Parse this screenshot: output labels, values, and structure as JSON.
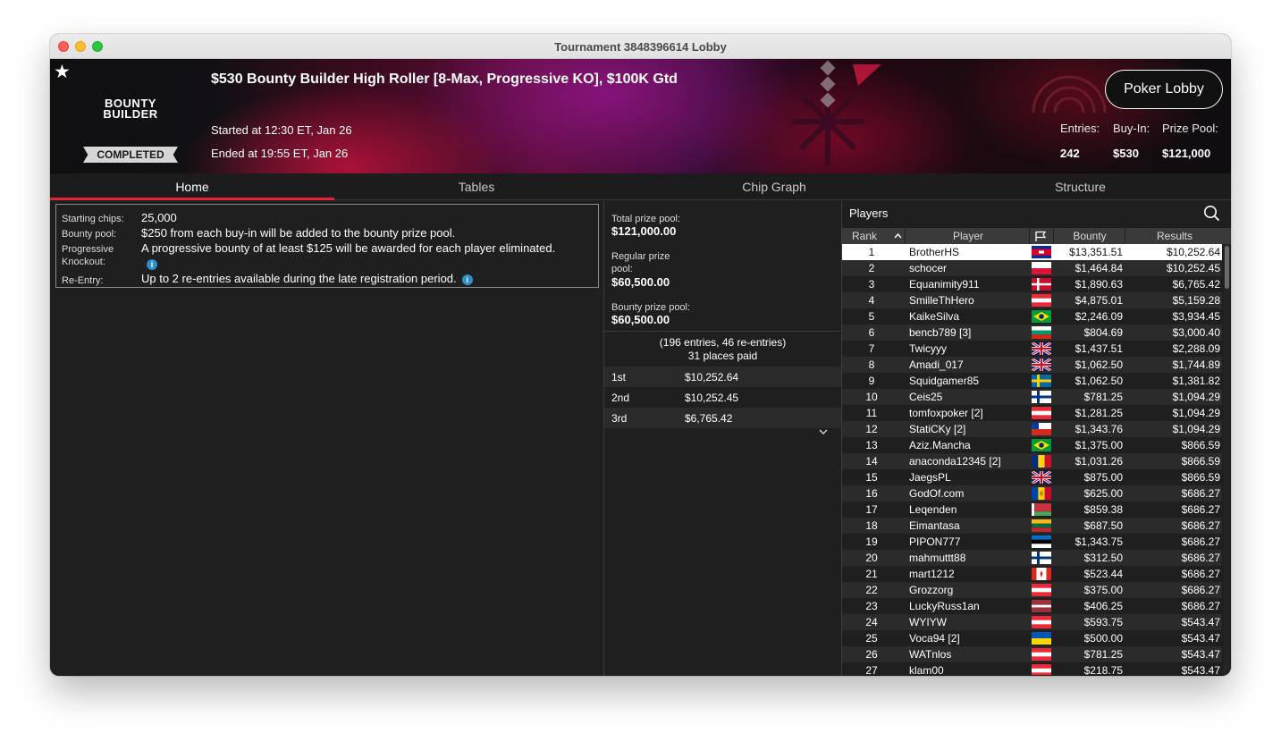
{
  "window": {
    "title": "Tournament 3848396614 Lobby"
  },
  "banner": {
    "logo_line1": "BOUNTY",
    "logo_line2": "BUILDER",
    "status": "COMPLETED",
    "title": "$530 Bounty Builder High Roller [8-Max, Progressive KO], $100K Gtd",
    "started": "Started at 12:30 ET, Jan 26",
    "ended": "Ended at 19:55 ET, Jan 26",
    "lobby_button": "Poker Lobby",
    "stats": [
      {
        "label": "Entries:",
        "value": "242"
      },
      {
        "label": "Buy-In:",
        "value": "$530"
      },
      {
        "label": "Prize Pool:",
        "value": "$121,000"
      }
    ]
  },
  "tabs": [
    "Home",
    "Tables",
    "Chip Graph",
    "Structure"
  ],
  "info": {
    "starting_chips_label": "Starting chips:",
    "starting_chips": "25,000",
    "bounty_pool_label": "Bounty pool:",
    "bounty_pool": "$250 from each buy-in will be added to the bounty prize pool.",
    "pko_label": "Progressive Knockout:",
    "pko": "A progressive bounty of at least $125 will be awarded for each player eliminated.",
    "reentry_label": "Re-Entry:",
    "reentry": "Up to 2 re-entries available during the late registration period."
  },
  "prizes": {
    "total_label": "Total prize pool:",
    "total": "$121,000.00",
    "regular_label": "Regular prize pool:",
    "regular": "$60,500.00",
    "bounty_label": "Bounty prize pool:",
    "bounty": "$60,500.00",
    "entries_line": "(196 entries, 46 re-entries)",
    "places_line": "31 places paid",
    "payouts": [
      {
        "place": "1st",
        "amount": "$10,252.64"
      },
      {
        "place": "2nd",
        "amount": "$10,252.45"
      },
      {
        "place": "3rd",
        "amount": "$6,765.42"
      }
    ]
  },
  "players": {
    "header": "Players",
    "columns": {
      "rank": "Rank",
      "player": "Player",
      "bounty": "Bounty",
      "results": "Results"
    },
    "rows": [
      {
        "rank": "1",
        "name": "BrotherHS",
        "flag": "cambodia",
        "bounty": "$13,351.51",
        "result": "$10,252.64"
      },
      {
        "rank": "2",
        "name": "schocer",
        "flag": "poland",
        "bounty": "$1,464.84",
        "result": "$10,252.45"
      },
      {
        "rank": "3",
        "name": "Equanimity911",
        "flag": "denmark",
        "bounty": "$1,890.63",
        "result": "$6,765.42"
      },
      {
        "rank": "4",
        "name": "SmilleThHero",
        "flag": "austria",
        "bounty": "$4,875.01",
        "result": "$5,159.28"
      },
      {
        "rank": "5",
        "name": "KaikeSilva",
        "flag": "brazil",
        "bounty": "$2,246.09",
        "result": "$3,934.45"
      },
      {
        "rank": "6",
        "name": "bencb789 [3]",
        "flag": "bulgaria",
        "bounty": "$804.69",
        "result": "$3,000.40"
      },
      {
        "rank": "7",
        "name": "Twicyyy",
        "flag": "uk",
        "bounty": "$1,437.51",
        "result": "$2,288.09"
      },
      {
        "rank": "8",
        "name": "Amadi_017",
        "flag": "uk",
        "bounty": "$1,062.50",
        "result": "$1,744.89"
      },
      {
        "rank": "9",
        "name": "Squidgamer85",
        "flag": "sweden",
        "bounty": "$1,062.50",
        "result": "$1,381.82"
      },
      {
        "rank": "10",
        "name": "Ceis25",
        "flag": "finland",
        "bounty": "$781.25",
        "result": "$1,094.29"
      },
      {
        "rank": "11",
        "name": "tomfoxpoker [2]",
        "flag": "austria",
        "bounty": "$1,281.25",
        "result": "$1,094.29"
      },
      {
        "rank": "12",
        "name": "StatiCKy [2]",
        "flag": "chile",
        "bounty": "$1,343.76",
        "result": "$1,094.29"
      },
      {
        "rank": "13",
        "name": "Aziz.Mancha",
        "flag": "brazil",
        "bounty": "$1,375.00",
        "result": "$866.59"
      },
      {
        "rank": "14",
        "name": "anaconda12345 [2]",
        "flag": "romania",
        "bounty": "$1,031.26",
        "result": "$866.59"
      },
      {
        "rank": "15",
        "name": "JaegsPL",
        "flag": "uk",
        "bounty": "$875.00",
        "result": "$866.59"
      },
      {
        "rank": "16",
        "name": "GodOf.com",
        "flag": "moldova",
        "bounty": "$625.00",
        "result": "$686.27"
      },
      {
        "rank": "17",
        "name": "Leqenden",
        "flag": "belarus",
        "bounty": "$859.38",
        "result": "$686.27"
      },
      {
        "rank": "18",
        "name": "Eimantasa",
        "flag": "lithuania",
        "bounty": "$687.50",
        "result": "$686.27"
      },
      {
        "rank": "19",
        "name": "PIPON777",
        "flag": "estonia",
        "bounty": "$1,343.75",
        "result": "$686.27"
      },
      {
        "rank": "20",
        "name": "mahmuttt88",
        "flag": "finland",
        "bounty": "$312.50",
        "result": "$686.27"
      },
      {
        "rank": "21",
        "name": "mart1212",
        "flag": "canada",
        "bounty": "$523.44",
        "result": "$686.27"
      },
      {
        "rank": "22",
        "name": "Grozzorg",
        "flag": "austria",
        "bounty": "$375.00",
        "result": "$686.27"
      },
      {
        "rank": "23",
        "name": "LuckyRuss1an",
        "flag": "latvia",
        "bounty": "$406.25",
        "result": "$686.27"
      },
      {
        "rank": "24",
        "name": "WYIYW",
        "flag": "austria",
        "bounty": "$593.75",
        "result": "$543.47"
      },
      {
        "rank": "25",
        "name": "Voca94 [2]",
        "flag": "ukraine",
        "bounty": "$500.00",
        "result": "$543.47"
      },
      {
        "rank": "26",
        "name": "WATnlos",
        "flag": "austria",
        "bounty": "$781.25",
        "result": "$543.47"
      },
      {
        "rank": "27",
        "name": "klam00",
        "flag": "austria",
        "bounty": "$218.75",
        "result": "$543.47"
      }
    ]
  },
  "colors": {
    "accent": "#e0223a",
    "info_icon": "#2e8fc9",
    "selected_row": "#ffffff"
  }
}
